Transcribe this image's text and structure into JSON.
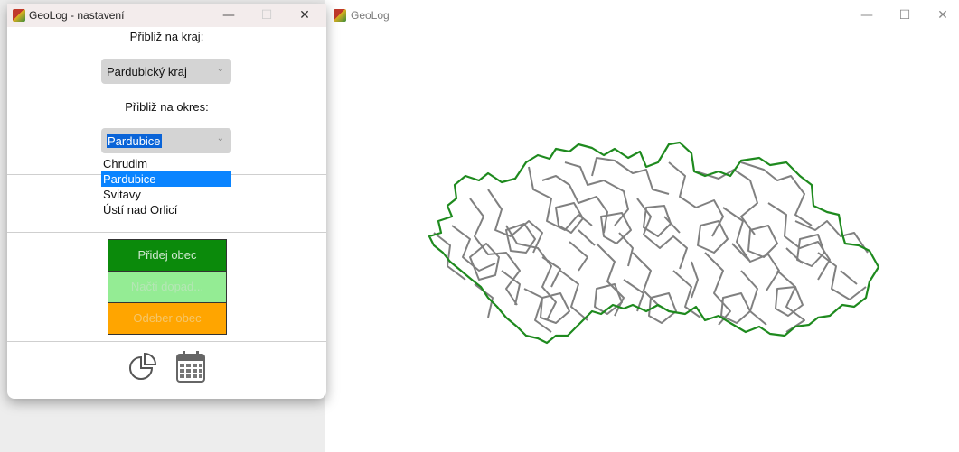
{
  "settings_window": {
    "title": "GeoLog - nastavení",
    "controls": {
      "minimize": "—",
      "maximize": "☐",
      "close": "✕"
    },
    "region_label": "Přibliž na kraj:",
    "region_value": "Pardubický kraj",
    "district_label": "Přibliž na okres:",
    "district_value": "Pardubice",
    "district_options": [
      "Chrudim",
      "Pardubice",
      "Svitavy",
      "Ústí nad Orlicí"
    ],
    "district_selected": "Pardubice",
    "buttons": {
      "add": "Přidej obec",
      "load": "Načti dopad...",
      "remove": "Odeber obec"
    },
    "icons": [
      "pie-chart-icon",
      "calendar-icon"
    ]
  },
  "main_window": {
    "title": "GeoLog",
    "controls": {
      "minimize": "—",
      "maximize": "☐",
      "close": "✕"
    }
  },
  "colors": {
    "region_border": "#1e8a1e",
    "municipality_border": "#808080",
    "add_button": "#0b8a0b",
    "load_button": "#94ec94",
    "remove_button": "#ffa500",
    "selection": "#0a84ff"
  }
}
